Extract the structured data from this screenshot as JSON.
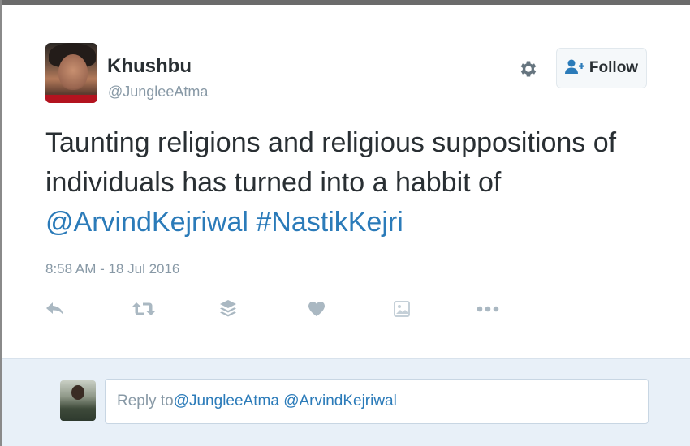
{
  "tweet": {
    "author": {
      "name": "Khushbu",
      "handle": "@JungleeAtma"
    },
    "text": {
      "line1": "Taunting religions and religious suppositions of",
      "line2": "individuals has turned into a habbit of",
      "mention": "@ArvindKejriwal",
      "hashtag": "#NastikKejri"
    },
    "timestamp": "8:58 AM - 18 Jul 2016",
    "actions": [
      "reply-icon",
      "retweet-icon",
      "buffer-icon",
      "like-icon",
      "photo-icon",
      "more-icon"
    ]
  },
  "header": {
    "follow_label": "Follow",
    "icons": [
      "gear-icon",
      "follow-user-icon"
    ]
  },
  "reply": {
    "prefix": "Reply to ",
    "mention1": "@JungleeAtma",
    "mention2": "@ArvindKejriwal"
  },
  "colors": {
    "link": "#2b7bb9",
    "text": "#292f33",
    "muted": "#8899a6",
    "reply_bar": "#e8f0f8"
  }
}
